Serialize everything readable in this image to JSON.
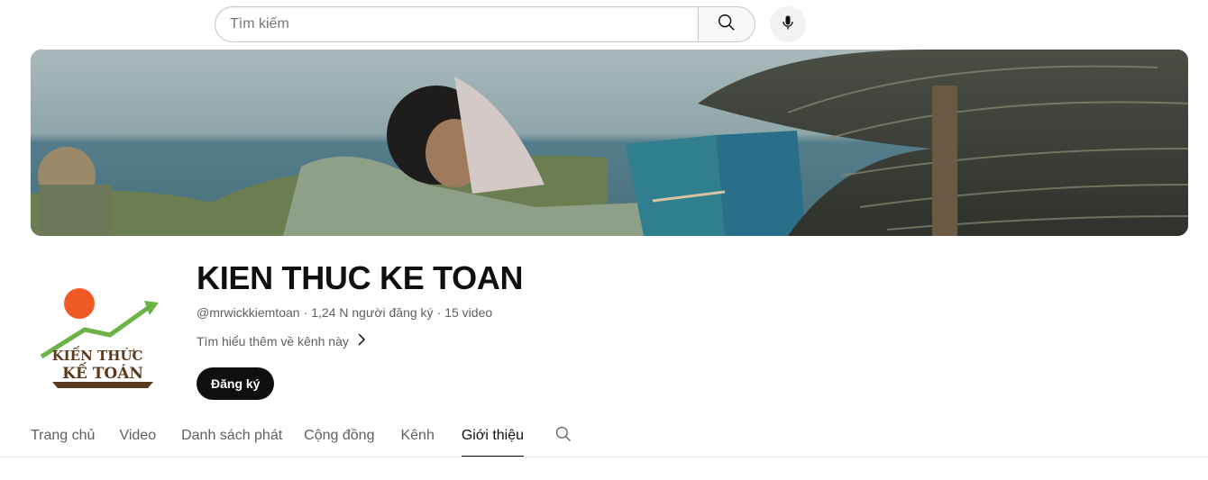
{
  "search": {
    "placeholder": "Tìm kiếm",
    "search_icon": "search-icon",
    "mic_icon": "microphone-icon"
  },
  "banner": {
    "description_icon": "channel-banner-image"
  },
  "channel": {
    "avatar_text_line1": "KIẾN THỨC",
    "avatar_text_line2": "KẾ TOÁN",
    "title": "KIEN THUC KE TOAN",
    "handle": "@mrwickkiemtoan",
    "subscribers": "1,24 N người đăng ký",
    "videos": "15 video",
    "separator": "·",
    "about_link": "Tìm hiểu thêm về kênh này",
    "subscribe_label": "Đăng ký"
  },
  "tabs": [
    {
      "label": "Trang chủ",
      "active": false
    },
    {
      "label": "Video",
      "active": false
    },
    {
      "label": "Danh sách phát",
      "active": false
    },
    {
      "label": "Cộng đồng",
      "active": false
    },
    {
      "label": "Kênh",
      "active": false
    },
    {
      "label": "Giới thiệu",
      "active": true
    }
  ],
  "colors": {
    "accent": "#0f0f0f",
    "secondary_text": "#606060",
    "logo_sun": "#f15a24",
    "logo_arrow": "#6ab344",
    "logo_text": "#5a3a1e"
  }
}
